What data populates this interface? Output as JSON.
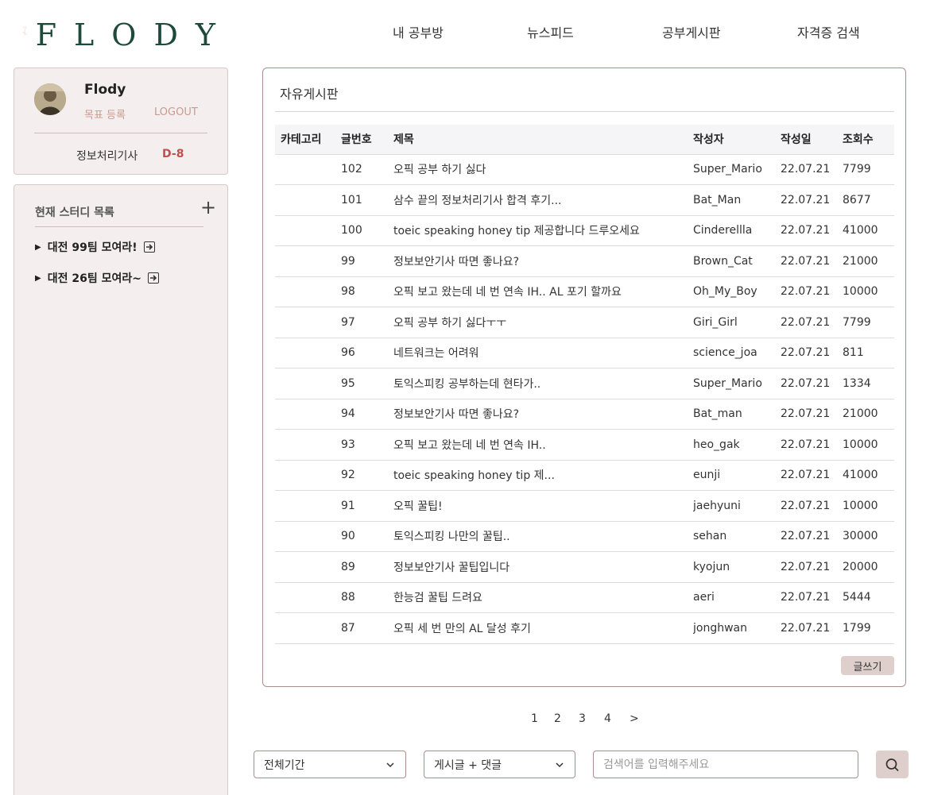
{
  "brand": {
    "name": "FLODY"
  },
  "nav": [
    "내 공부방",
    "뉴스피드",
    "공부게시판",
    "자격증 검색"
  ],
  "profile": {
    "name": "Flody",
    "goal_label": "목표 등록",
    "logout_label": "LOGOUT",
    "certificate": "정보처리기사",
    "dday": "D-8"
  },
  "studies": {
    "title": "현재 스터디 목록",
    "add_icon": "plus-icon",
    "items": [
      "대전 99팀 모여라!",
      "대전 26팀 모여라~"
    ]
  },
  "board": {
    "title": "자유게시판",
    "columns": [
      "카테고리",
      "글번호",
      "제목",
      "작성자",
      "작성일",
      "조회수"
    ],
    "rows": [
      {
        "category": "",
        "no": "102",
        "title": "오픽 공부 하기 싫다",
        "author": "Super_Mario",
        "date": "22.07.21",
        "views": "7799"
      },
      {
        "category": "",
        "no": "101",
        "title": "삼수 끝의 정보처리기사 합격 후기...",
        "author": "Bat_Man",
        "date": "22.07.21",
        "views": "8677"
      },
      {
        "category": "",
        "no": "100",
        "title": "toeic speaking honey tip 제공합니다 드루오세요",
        "author": "Cinderellla",
        "date": "22.07.21",
        "views": "41000"
      },
      {
        "category": "",
        "no": "99",
        "title": "정보보안기사 따면 좋나요?",
        "author": "Brown_Cat",
        "date": "22.07.21",
        "views": "21000"
      },
      {
        "category": "",
        "no": "98",
        "title": "오픽 보고 왔는데 네 번 연속 IH.. AL 포기 할까요",
        "author": "Oh_My_Boy",
        "date": "22.07.21",
        "views": "10000"
      },
      {
        "category": "",
        "no": "97",
        "title": "오픽 공부 하기 싫다ㅜㅜ",
        "author": "Giri_Girl",
        "date": "22.07.21",
        "views": "7799"
      },
      {
        "category": "",
        "no": "96",
        "title": "네트워크는 어려워",
        "author": "science_joa",
        "date": "22.07.21",
        "views": "811"
      },
      {
        "category": "",
        "no": "95",
        "title": "토익스피킹 공부하는데 현타가..",
        "author": "Super_Mario",
        "date": "22.07.21",
        "views": "1334"
      },
      {
        "category": "",
        "no": "94",
        "title": "정보보안기사 따면 좋나요?",
        "author": "Bat_man",
        "date": "22.07.21",
        "views": "21000"
      },
      {
        "category": "",
        "no": "93",
        "title": "오픽 보고 왔는데 네 번 연속 IH..",
        "author": "heo_gak",
        "date": "22.07.21",
        "views": "10000"
      },
      {
        "category": "",
        "no": "92",
        "title": "toeic speaking honey tip 제...",
        "author": "eunji",
        "date": "22.07.21",
        "views": "41000"
      },
      {
        "category": "",
        "no": "91",
        "title": "오픽 꿀팁!",
        "author": "jaehyuni",
        "date": "22.07.21",
        "views": "10000"
      },
      {
        "category": "",
        "no": "90",
        "title": "토익스피킹 나만의 꿀팁..",
        "author": "sehan",
        "date": "22.07.21",
        "views": "30000"
      },
      {
        "category": "",
        "no": "89",
        "title": "정보보안기사 꿀팁입니다",
        "author": "kyojun",
        "date": "22.07.21",
        "views": "20000"
      },
      {
        "category": "",
        "no": "88",
        "title": "한능검 꿀팁 드려요",
        "author": "aeri",
        "date": "22.07.21",
        "views": "5444"
      },
      {
        "category": "",
        "no": "87",
        "title": "오픽 세 번 만의 AL 달성 후기",
        "author": "jonghwan",
        "date": "22.07.21",
        "views": "1799"
      }
    ],
    "write_label": "글쓰기"
  },
  "pagination": [
    "1",
    "2",
    "3",
    "4",
    ">"
  ],
  "search": {
    "period": "전체기간",
    "scope": "게시글 + 댓글",
    "placeholder": "검색어를 입력해주세요"
  },
  "colors": {
    "brand_green": "#1f4a3b",
    "accent_rose": "#c79b91",
    "dday_red": "#c0504d",
    "sidebar_bg": "#f4efee",
    "button_bg": "#dfcfcc"
  }
}
